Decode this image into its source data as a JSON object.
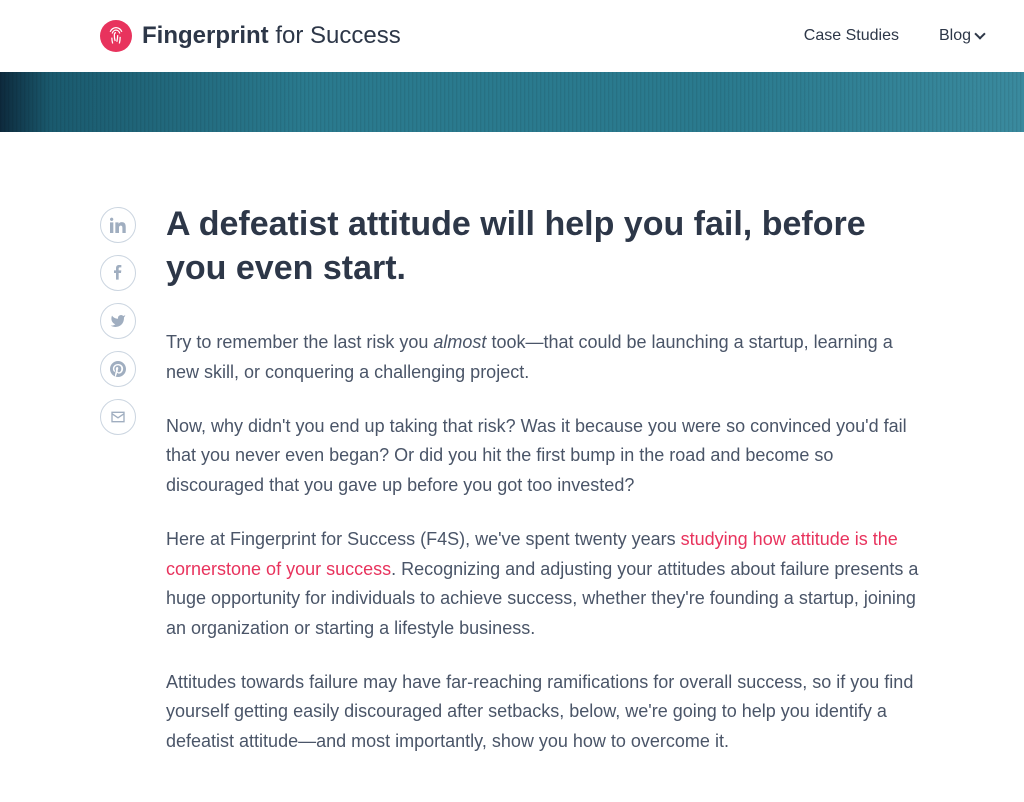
{
  "header": {
    "logo_bold": "Fingerprint",
    "logo_light": " for Success",
    "nav": {
      "case_studies": "Case Studies",
      "blog": "Blog"
    }
  },
  "social": {
    "linkedin": "linkedin-icon",
    "facebook": "facebook-icon",
    "twitter": "twitter-icon",
    "pinterest": "pinterest-icon",
    "email": "email-icon"
  },
  "article": {
    "title": "A defeatist attitude will help you fail, before you even start.",
    "p1_before": "Try to remember the last risk you ",
    "p1_em": "almost",
    "p1_after": " took—that could be launching a startup, learning a new skill, or conquering a challenging project.",
    "p2": "Now, why didn't you end up taking that risk? Was it because you were so convinced you'd fail that you never even began? Or did you hit the first bump in the road and become so discouraged that you gave up before you got too invested?",
    "p3_before": "Here at Fingerprint for Success (F4S), we've spent twenty years ",
    "p3_link": "studying how attitude is the cornerstone of your success",
    "p3_after": ". Recognizing and adjusting your attitudes about failure presents a huge opportunity for individuals to achieve success, whether they're founding a startup,  joining an organization or starting a lifestyle business.",
    "p4": "Attitudes towards failure may have far-reaching ramifications for overall success, so if you find yourself getting easily discouraged after setbacks, below, we're going to help you identify a defeatist attitude—and most importantly, show you how to overcome it."
  },
  "colors": {
    "accent": "#e8335d"
  }
}
